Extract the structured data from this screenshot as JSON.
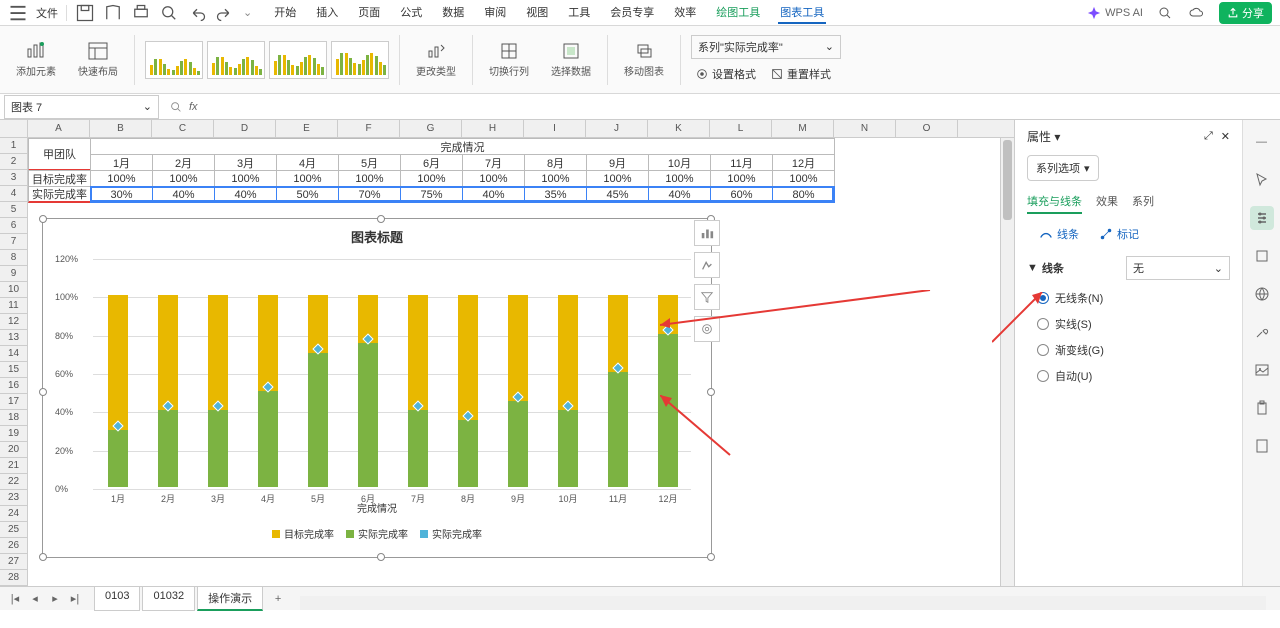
{
  "toolbar": {
    "file_menu": "文件",
    "tabs": [
      "开始",
      "插入",
      "页面",
      "公式",
      "数据",
      "审阅",
      "视图",
      "工具",
      "会员专享",
      "效率",
      "绘图工具",
      "图表工具"
    ],
    "active_tab_index": 11,
    "green_tab_indices": [
      10,
      11
    ],
    "wps_ai": "WPS AI",
    "share": "分享"
  },
  "ribbon": {
    "add_element": "添加元素",
    "quick_layout": "快速布局",
    "change_type": "更改类型",
    "switch_rc": "切换行列",
    "select_data": "选择数据",
    "move_chart": "移动图表",
    "series_combo": "系列\"实际完成率\"",
    "set_format": "设置格式",
    "reset_style": "重置样式"
  },
  "name_box": "图表 7",
  "fx_label": "fx",
  "columns": [
    "A",
    "B",
    "C",
    "D",
    "E",
    "F",
    "G",
    "H",
    "I",
    "J",
    "K",
    "L",
    "M",
    "N",
    "O"
  ],
  "row_count": 28,
  "table": {
    "team": "甲团队",
    "header_merged": "完成情况",
    "months": [
      "1月",
      "2月",
      "3月",
      "4月",
      "5月",
      "6月",
      "7月",
      "8月",
      "9月",
      "10月",
      "11月",
      "12月"
    ],
    "target_label": "目标完成率",
    "actual_label": "实际完成率",
    "target": [
      "100%",
      "100%",
      "100%",
      "100%",
      "100%",
      "100%",
      "100%",
      "100%",
      "100%",
      "100%",
      "100%",
      "100%"
    ],
    "actual": [
      "30%",
      "40%",
      "40%",
      "50%",
      "70%",
      "75%",
      "40%",
      "35%",
      "45%",
      "40%",
      "60%",
      "80%"
    ]
  },
  "chart_data": {
    "type": "bar",
    "title": "图表标题",
    "categories": [
      "1月",
      "2月",
      "3月",
      "4月",
      "5月",
      "6月",
      "7月",
      "8月",
      "9月",
      "10月",
      "11月",
      "12月"
    ],
    "series": [
      {
        "name": "目标完成率",
        "values": [
          100,
          100,
          100,
          100,
          100,
          100,
          100,
          100,
          100,
          100,
          100,
          100
        ],
        "color": "#e8b800"
      },
      {
        "name": "实际完成率",
        "values": [
          30,
          40,
          40,
          50,
          70,
          75,
          40,
          35,
          45,
          40,
          60,
          80
        ],
        "color": "#7cb342"
      },
      {
        "name": "实际完成率",
        "values": [
          30,
          40,
          40,
          50,
          70,
          75,
          40,
          35,
          45,
          40,
          60,
          80
        ],
        "color": "#4fb3d9"
      }
    ],
    "xlabel": "完成情况",
    "ylabel": "",
    "ylim": [
      0,
      120
    ],
    "y_ticks": [
      "0%",
      "20%",
      "40%",
      "60%",
      "80%",
      "100%",
      "120%"
    ]
  },
  "prop_panel": {
    "title": "属性",
    "combo": "系列选项",
    "tabs": [
      "填充与线条",
      "效果",
      "系列"
    ],
    "active_tab": 0,
    "subtabs": [
      "线条",
      "标记"
    ],
    "section_title": "线条",
    "line_select": "无",
    "radios": [
      "无线条(N)",
      "实线(S)",
      "渐变线(G)",
      "自动(U)"
    ],
    "radio_selected": 0
  },
  "sheet_tabs": [
    "0103",
    "01032",
    "操作演示"
  ],
  "active_sheet": 2
}
